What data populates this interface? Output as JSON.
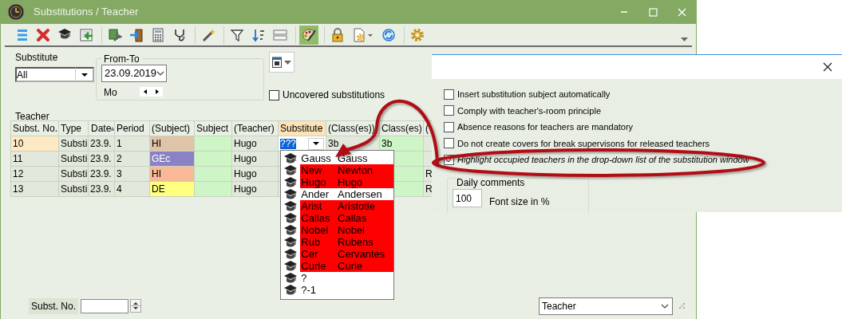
{
  "window": {
    "title": "Substitutions / Teacher"
  },
  "toolbar": [
    {
      "kind": "list",
      "pressed": false
    },
    {
      "kind": "delete",
      "pressed": false
    },
    {
      "kind": "hat",
      "pressed": false
    },
    {
      "kind": "import",
      "pressed": false
    },
    {
      "kind": "separator"
    },
    {
      "kind": "wrench",
      "pressed": false
    },
    {
      "kind": "door",
      "pressed": false
    },
    {
      "kind": "calculator",
      "pressed": false
    },
    {
      "kind": "stethoscope",
      "pressed": false
    },
    {
      "kind": "separator"
    },
    {
      "kind": "wand",
      "pressed": false
    },
    {
      "kind": "separator"
    },
    {
      "kind": "filter",
      "pressed": false
    },
    {
      "kind": "sort",
      "pressed": false
    },
    {
      "kind": "columns",
      "pressed": false
    },
    {
      "kind": "separator"
    },
    {
      "kind": "palette",
      "pressed": true
    },
    {
      "kind": "separator"
    },
    {
      "kind": "lock",
      "pressed": false
    },
    {
      "kind": "docgear",
      "pressed": false
    },
    {
      "kind": "refresh",
      "pressed": false
    },
    {
      "kind": "separator"
    },
    {
      "kind": "gear",
      "pressed": false
    }
  ],
  "filters": {
    "substitute_label": "Substitute",
    "substitute_value": "All",
    "from_to_label": "From-To",
    "date": "23.09.2019",
    "weekday": "Mo",
    "uncovered": {
      "label": "Uncovered substitutions",
      "checked": false
    }
  },
  "table": {
    "title": "Teacher",
    "columns": [
      {
        "label": "Subst. No.",
        "selected": false,
        "sorted": false
      },
      {
        "label": "Type",
        "selected": false,
        "sorted": false
      },
      {
        "label": "Date",
        "selected": false,
        "sorted": true
      },
      {
        "label": "Period",
        "selected": false,
        "sorted": false
      },
      {
        "label": "(Subject)",
        "selected": false,
        "sorted": false
      },
      {
        "label": "Subject",
        "selected": false,
        "sorted": false
      },
      {
        "label": "(Teacher)",
        "selected": false,
        "sorted": false
      },
      {
        "label": "Substitute",
        "selected": true,
        "sorted": false
      },
      {
        "label": "(Class(es))",
        "selected": false,
        "sorted": false
      },
      {
        "label": "Class(es)",
        "selected": false,
        "sorted": false
      },
      {
        "label": "(",
        "selected": false
      }
    ],
    "rows": [
      {
        "selected": true,
        "color": "#dfc4a8",
        "cells": {
          "no": "10",
          "type": "Substi",
          "date": "23.9.",
          "period": "1",
          "subject_planned": "HI",
          "teacher": "Hugo",
          "substitute": "???",
          "classes_planned": "3b",
          "classes": "3b"
        }
      },
      {
        "selected": false,
        "color": "#8a82c4",
        "cells": {
          "no": "11",
          "type": "Substi",
          "date": "23.9.",
          "period": "2",
          "subject_planned": "GEc",
          "teacher": "Hugo"
        }
      },
      {
        "selected": false,
        "color": "#f9b898",
        "cells": {
          "no": "12",
          "type": "Substi",
          "date": "23.9.",
          "period": "3",
          "subject_planned": "HI",
          "teacher": "Hugo",
          "column_11": "R"
        }
      },
      {
        "selected": false,
        "color": "#ffff80",
        "cells": {
          "no": "13",
          "type": "Substi",
          "date": "23.9.",
          "period": "4",
          "subject_planned": "DE",
          "teacher": "Hugo",
          "column_11": "R"
        }
      }
    ]
  },
  "dropdown": {
    "items": [
      {
        "short": "Gauss",
        "name": "Gauss",
        "occupied": false
      },
      {
        "short": "New",
        "name": "Newton",
        "occupied": true
      },
      {
        "short": "Hugo",
        "name": "Hugo",
        "occupied": true
      },
      {
        "short": "Ander",
        "name": "Andersen",
        "occupied": false
      },
      {
        "short": "Arist",
        "name": "Aristotle",
        "occupied": true
      },
      {
        "short": "Callas",
        "name": "Callas",
        "occupied": true
      },
      {
        "short": "Nobel",
        "name": "Nobel",
        "occupied": true
      },
      {
        "short": "Rub",
        "name": "Rubens",
        "occupied": true
      },
      {
        "short": "Cer",
        "name": "Cervantes",
        "occupied": true
      },
      {
        "short": "Curie",
        "name": "Curie",
        "occupied": true
      },
      {
        "short": "?",
        "occupied": false
      },
      {
        "short": "?-1",
        "occupied": false
      }
    ]
  },
  "footer": {
    "subst_no_label": "Subst. No.",
    "view": "Teacher"
  },
  "dialog": {
    "options": [
      {
        "label": "Insert substitution subject automatically",
        "checked": false,
        "italic": false
      },
      {
        "label": "Comply with teacher's-room principle",
        "checked": false,
        "italic": false
      },
      {
        "label": "Absence reasons for teachers are mandatory",
        "checked": false,
        "italic": false
      },
      {
        "label": "Do not create covers for break supervisons for released teachers",
        "checked": false,
        "italic": false
      },
      {
        "label": "Highlight occupied teachers in the drop-down list of the substitution window",
        "checked": true,
        "italic": true
      }
    ],
    "daily_comments": {
      "title": "Daily comments",
      "font_size": "100",
      "font_size_label": "Font size in %"
    }
  }
}
